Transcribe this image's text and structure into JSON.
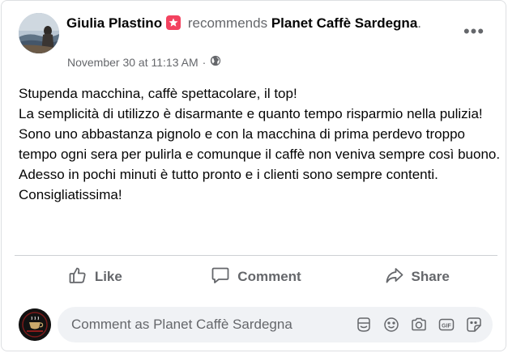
{
  "post": {
    "author": "Giulia Plastino",
    "verb": "recommends",
    "page": "Planet Caffè Sardegna",
    "period": ".",
    "timestamp": "November 30 at 11:13 AM",
    "dot": "·",
    "privacy_icon": "globe-icon",
    "more_label": "•••",
    "body": [
      "Stupenda macchina, caffè spettacolare, il top!",
      "La semplicità di utilizzo è disarmante e quanto tempo risparmio nella pulizia!",
      "Sono uno abbastanza pignolo e con la macchina di prima perdevo troppo tempo ogni sera per pulirla e comunque il caffè non veniva sempre così buono.",
      "Adesso in pochi minuti è tutto pronto e i clienti sono sempre contenti. Consigliatissima!"
    ]
  },
  "actions": {
    "like": "Like",
    "comment": "Comment",
    "share": "Share"
  },
  "composer": {
    "placeholder": "Comment as Planet Caffè Sardegna",
    "icons": [
      "avatar-sticker-icon",
      "emoji-icon",
      "camera-icon",
      "gif-icon",
      "sticker-icon"
    ]
  },
  "colors": {
    "recommend_badge": "#f3425f",
    "secondary_text": "#65676b",
    "divider": "#ced0d4",
    "composer_bg": "#f0f2f5"
  }
}
